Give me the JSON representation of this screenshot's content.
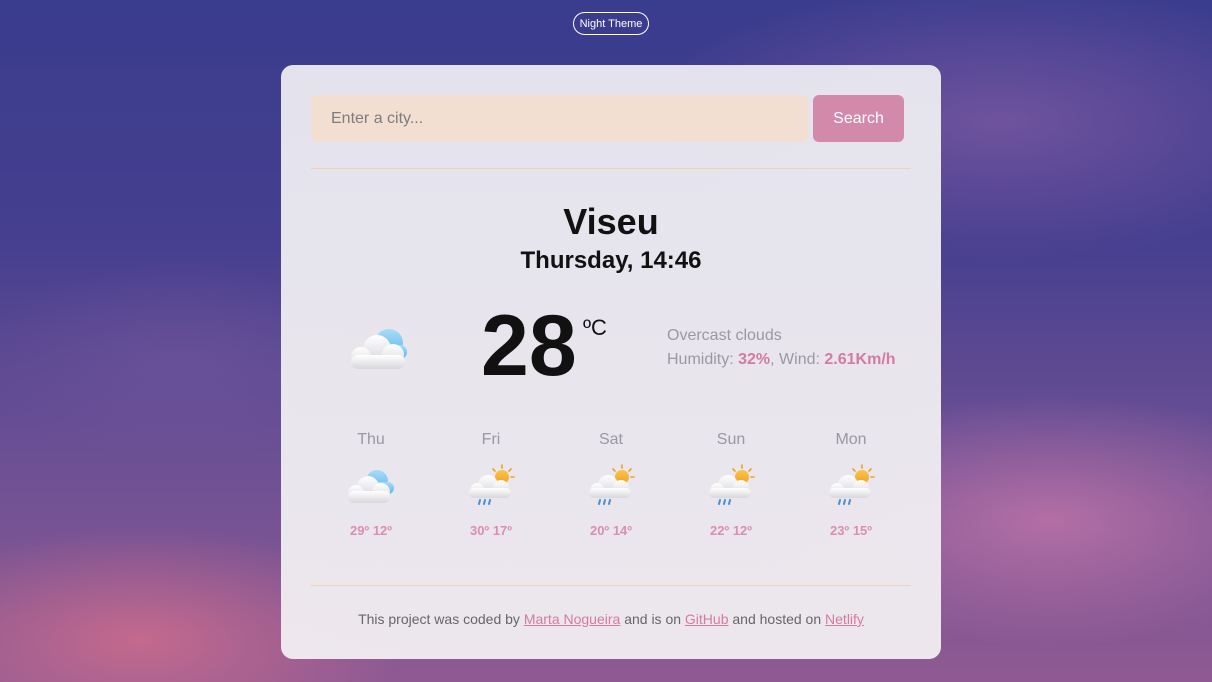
{
  "theme_toggle": {
    "label": "Night Theme"
  },
  "search": {
    "placeholder": "Enter a city...",
    "button_label": "Search"
  },
  "current": {
    "city": "Viseu",
    "datetime": "Thursday, 14:46",
    "temperature": "28",
    "unit": "ºC",
    "description": "Overcast clouds",
    "humidity_label": "Humidity: ",
    "humidity_value": "32%",
    "wind_label": ", Wind: ",
    "wind_value": "2.61Km/h",
    "icon": "cloud-icon"
  },
  "forecast": [
    {
      "day": "Thu",
      "max": "29º",
      "min": "12º",
      "icon": "cloud-icon"
    },
    {
      "day": "Fri",
      "max": "30º",
      "min": "17º",
      "icon": "sun-cloud-rain-icon"
    },
    {
      "day": "Sat",
      "max": "20º",
      "min": "14º",
      "icon": "sun-cloud-rain-icon"
    },
    {
      "day": "Sun",
      "max": "22º",
      "min": "12º",
      "icon": "sun-cloud-rain-icon"
    },
    {
      "day": "Mon",
      "max": "23º",
      "min": "15º",
      "icon": "sun-cloud-rain-icon"
    }
  ],
  "footer": {
    "text_1": "This project was coded by ",
    "author_link": "Marta Nogueira",
    "text_2": " and is on ",
    "github_link": "GitHub",
    "text_3": " and hosted on ",
    "netlify_link": "Netlify"
  },
  "colors": {
    "accent": "#d27ba3",
    "search_button": "#d38aaa",
    "search_input_bg": "#f2dfd2",
    "divider": "#f3d2b4"
  }
}
